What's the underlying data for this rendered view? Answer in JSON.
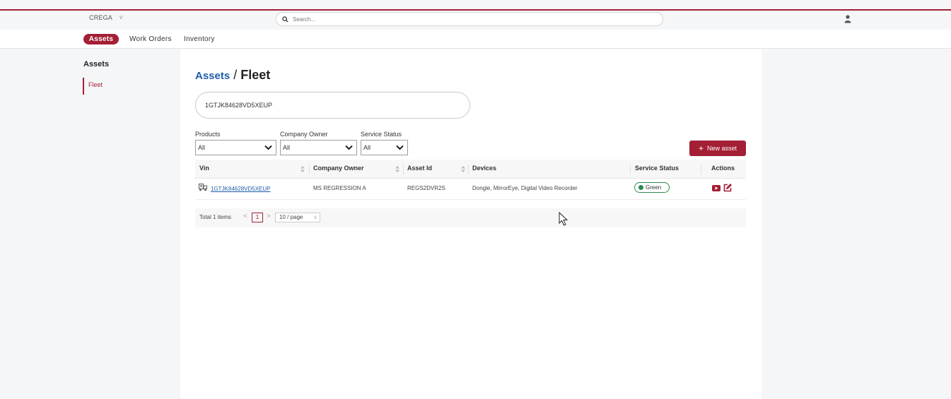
{
  "topbar": {
    "org_name": "CREGA",
    "search_placeholder": "Search..."
  },
  "nav": {
    "items": [
      "Assets",
      "Work Orders",
      "Inventory"
    ],
    "active": "Assets"
  },
  "sidebar": {
    "title": "Assets",
    "items": [
      "Fleet"
    ]
  },
  "breadcrumb": {
    "parent": "Assets",
    "separator": "/",
    "current": "Fleet"
  },
  "vin_search": {
    "value": "1GTJK84628VD5XEUP"
  },
  "filters": {
    "products": {
      "label": "Products",
      "value": "All"
    },
    "company_owner": {
      "label": "Company Owner",
      "value": "All"
    },
    "service_status": {
      "label": "Service Status",
      "value": "All"
    }
  },
  "new_asset_label": "New asset",
  "table": {
    "columns": [
      "Vin",
      "Company Owner",
      "Asset Id",
      "Devices",
      "Service Status",
      "Actions"
    ],
    "rows": [
      {
        "vin": "1GTJK84628VD5XEUP",
        "company_owner": "MS REGRESSION A",
        "asset_id": "REGS2DVR2S",
        "devices": "Dongle, MirrorEye, Digital Video Recorder",
        "service_status": "Green"
      }
    ]
  },
  "pagination": {
    "total_text": "Total 1 items",
    "current_page": "1",
    "page_size": "10 / page"
  },
  "colors": {
    "accent": "#a31f34",
    "link": "#1f5ea8",
    "status_green": "#2b8a4b"
  }
}
